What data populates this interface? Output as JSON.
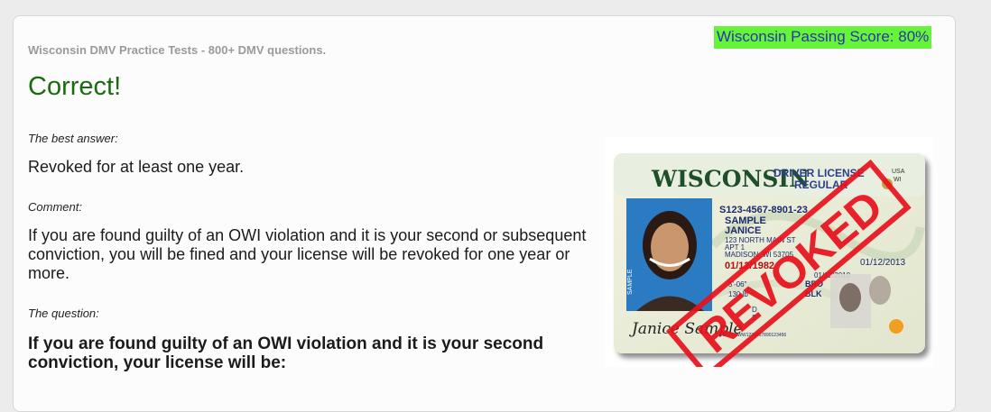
{
  "header": {
    "site_title": "Wisconsin DMV Practice Tests - 800+ DMV questions.",
    "passing_score": "Wisconsin Passing Score: 80%"
  },
  "result": {
    "text": "Correct!"
  },
  "answer_section": {
    "label": "The best answer:",
    "text": "Revoked for at least one year."
  },
  "comment_section": {
    "label": "Comment:",
    "text": "If you are found guilty of an OWI violation and it is your second or subsequent conviction, you will be fined and your license will be revoked for one year or more."
  },
  "question_section": {
    "label": "The question:",
    "text": "If you are found guilty of an OWI violation and it is your second conviction, your license will be:"
  },
  "license": {
    "state": "WISCONSIN",
    "type_line1": "DRIVER LICENSE",
    "type_line2": "REGULAR",
    "usa": "USA",
    "wi": "WI",
    "dl_number": "S123-4567-8901-23",
    "last_name": "SAMPLE",
    "first_name": "JANICE",
    "address1": "123 NORTH MAIN ST",
    "address2": "APT 1",
    "city": "MADISON, WI 53705",
    "dob": "01/12/1982",
    "exp": "01/12/2013",
    "iss": "01/12/2010",
    "height": "5'-06\"",
    "weight": "130 lb",
    "eyes": "BRO",
    "hair": "BLK",
    "class": "D",
    "end": "S",
    "barcode_text": "DD OTWWW1234567890123456",
    "signature": "Janice Sample",
    "stamp": "REVOKED",
    "photo_side_label": "SAMPLE",
    "colors": {
      "stamp": "#e8101c",
      "state_text": "#1f4f2a",
      "header_text": "#2c3e8a"
    }
  }
}
